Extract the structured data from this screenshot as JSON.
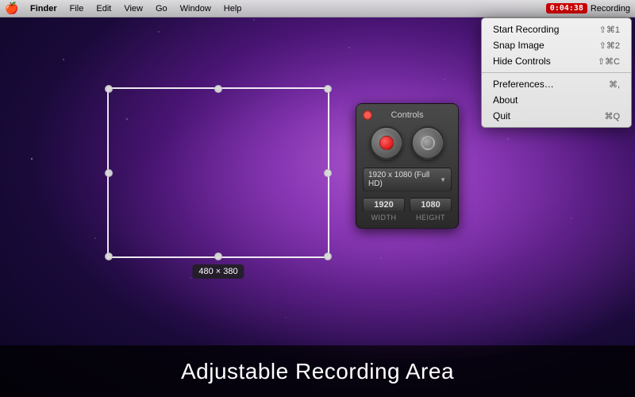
{
  "menubar": {
    "apple": "🍎",
    "items": [
      "Finder",
      "File",
      "Edit",
      "View",
      "Go",
      "Window",
      "Help"
    ],
    "timer": "0:04:38",
    "recording_label": "Recording"
  },
  "context_menu": {
    "items": [
      {
        "label": "Start Recording",
        "shortcut": "⇧⌘1"
      },
      {
        "label": "Snap Image",
        "shortcut": "⇧⌘2"
      },
      {
        "label": "Hide Controls",
        "shortcut": "⇧⌘C"
      },
      {
        "separator": true
      },
      {
        "label": "Preferences…",
        "shortcut": "⌘,"
      },
      {
        "label": "About",
        "shortcut": ""
      },
      {
        "label": "Quit",
        "shortcut": "⌘Q"
      }
    ]
  },
  "selection": {
    "size_label": "480 × 380"
  },
  "controls": {
    "title": "Controls",
    "resolution": "1920 x 1080 (Full HD)",
    "width": "1920",
    "height": "1080",
    "width_label": "WIDTH",
    "height_label": "HEIGHT"
  },
  "caption": {
    "text": "Adjustable Recording Area"
  }
}
